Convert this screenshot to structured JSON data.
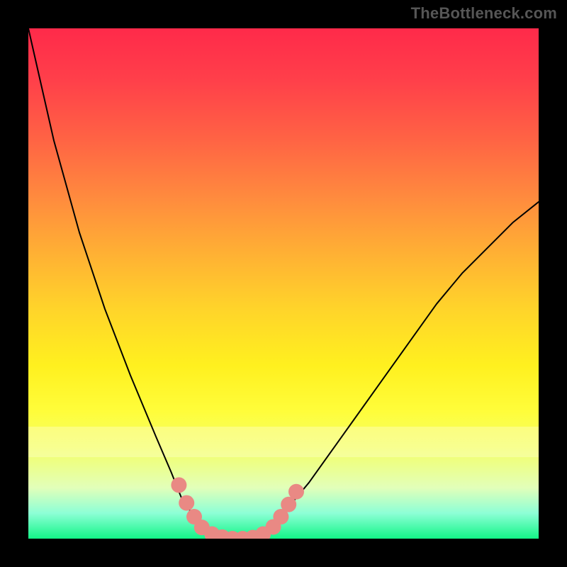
{
  "watermark": "TheBottleneck.com",
  "chart_data": {
    "type": "line",
    "title": "",
    "xlabel": "",
    "ylabel": "",
    "xlim": [
      0,
      100
    ],
    "ylim": [
      0,
      100
    ],
    "grid": false,
    "legend": false,
    "gradient_stops": [
      {
        "pos": 0,
        "color": "#ff2a4a"
      },
      {
        "pos": 10,
        "color": "#ff3f4a"
      },
      {
        "pos": 22,
        "color": "#ff6444"
      },
      {
        "pos": 33,
        "color": "#ff8a3e"
      },
      {
        "pos": 44,
        "color": "#ffb034"
      },
      {
        "pos": 55,
        "color": "#ffd42a"
      },
      {
        "pos": 66,
        "color": "#fff01f"
      },
      {
        "pos": 75,
        "color": "#fffd3a"
      },
      {
        "pos": 82,
        "color": "#f4ff66"
      },
      {
        "pos": 90,
        "color": "#e2ffb9"
      },
      {
        "pos": 95,
        "color": "#8dffd6"
      },
      {
        "pos": 100,
        "color": "#13f587"
      }
    ],
    "highlight_band_y": [
      78,
      84
    ],
    "series": [
      {
        "name": "curve",
        "x": [
          0,
          5,
          10,
          15,
          20,
          25,
          28,
          30,
          32,
          34,
          36,
          38,
          40,
          42,
          44,
          46,
          48,
          50,
          55,
          60,
          65,
          70,
          75,
          80,
          85,
          90,
          95,
          100
        ],
        "y": [
          100,
          78,
          60,
          45,
          32,
          20,
          13,
          8,
          5,
          2.5,
          1.2,
          0.3,
          0,
          0,
          0.2,
          1.0,
          2.5,
          5,
          11,
          18,
          25,
          32,
          39,
          46,
          52,
          57,
          62,
          66
        ]
      }
    ],
    "markers": {
      "name": "marker-dots",
      "color": "#e98984",
      "radius_px": 11,
      "points": [
        {
          "x": 29.5,
          "y": 10.5
        },
        {
          "x": 31.0,
          "y": 7.0
        },
        {
          "x": 32.5,
          "y": 4.3
        },
        {
          "x": 34.0,
          "y": 2.2
        },
        {
          "x": 36.0,
          "y": 0.9
        },
        {
          "x": 38.0,
          "y": 0.3
        },
        {
          "x": 40.0,
          "y": 0.0
        },
        {
          "x": 42.0,
          "y": 0.0
        },
        {
          "x": 44.0,
          "y": 0.2
        },
        {
          "x": 46.0,
          "y": 0.9
        },
        {
          "x": 48.0,
          "y": 2.3
        },
        {
          "x": 49.5,
          "y": 4.3
        },
        {
          "x": 51.0,
          "y": 6.7
        },
        {
          "x": 52.5,
          "y": 9.2
        }
      ]
    },
    "valley_x_range": [
      36,
      44
    ]
  }
}
